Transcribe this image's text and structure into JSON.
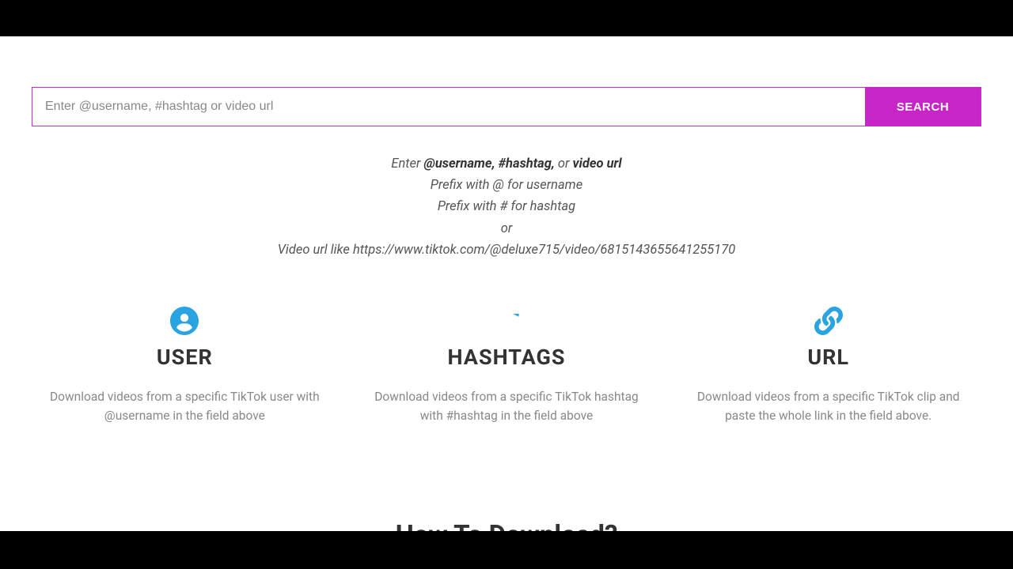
{
  "search": {
    "placeholder": "Enter @username, #hashtag or video url",
    "button": "SEARCH"
  },
  "instructions": {
    "line1_prefix": "Enter ",
    "line1_bold1": "@username, #hashtag,",
    "line1_mid": " or ",
    "line1_bold2": "video url",
    "line2": "Prefix with @ for username",
    "line3": "Prefix with # for hashtag",
    "line4": "or",
    "line5": "Video url like https://www.tiktok.com/@deluxe715/video/6815143655641255170"
  },
  "features": [
    {
      "title": "USER",
      "desc": "Download videos from a specific TikTok user with @username in the field above"
    },
    {
      "title": "HASHTAGS",
      "desc": "Download videos from a specific TikTok hashtag with #hashtag in the field above"
    },
    {
      "title": "URL",
      "desc": "Download videos from a specific TikTok clip and paste the whole link in the field above."
    }
  ],
  "howto_heading": "How To Download?"
}
